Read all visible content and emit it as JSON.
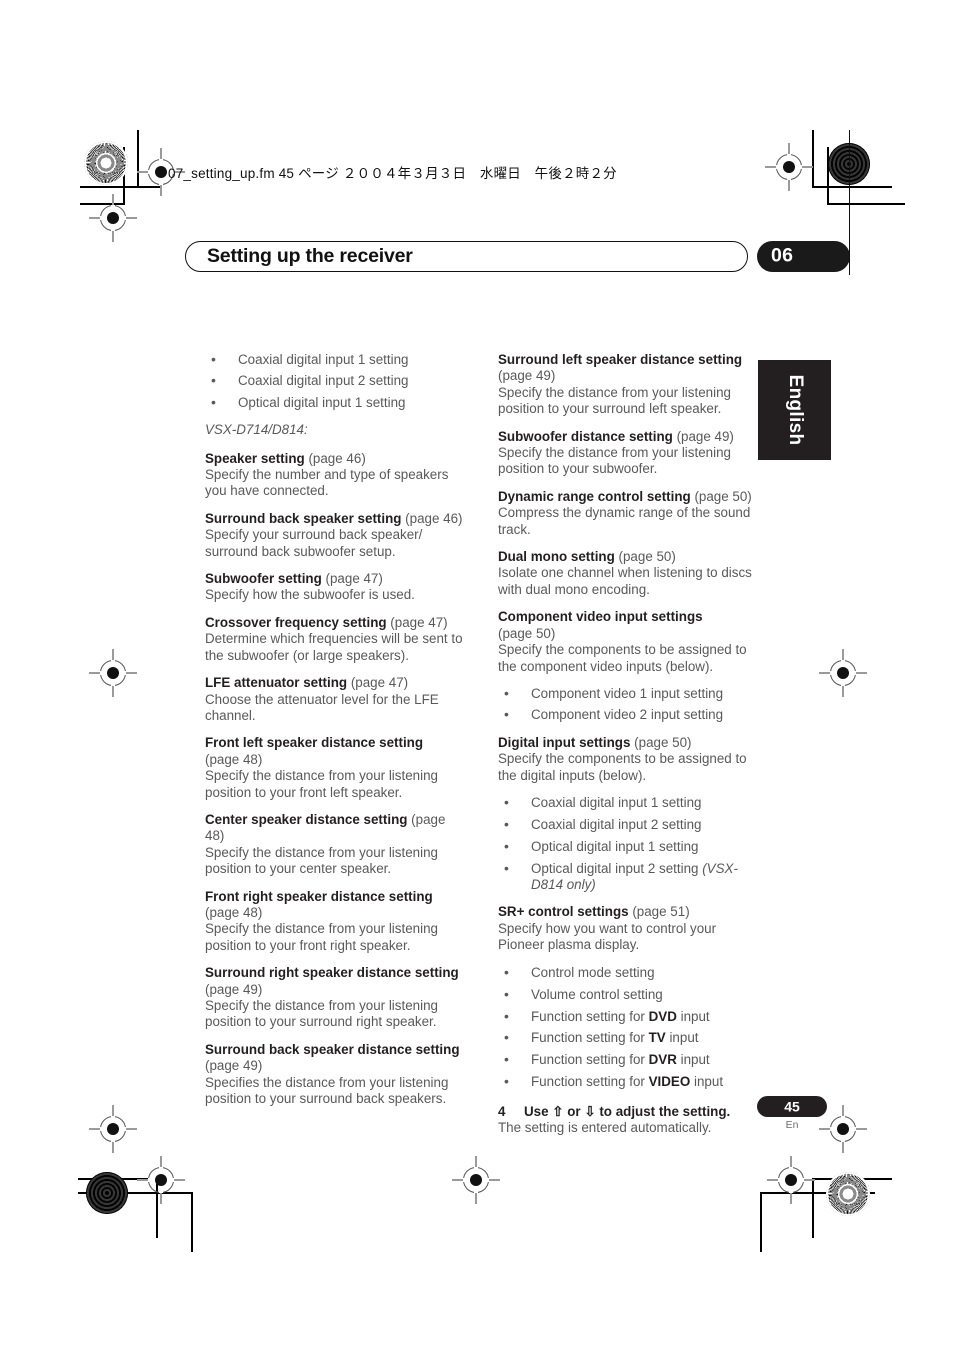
{
  "header": {
    "file_info": "07_setting_up.fm  45 ページ  ２００４年３月３日　水曜日　午後２時２分"
  },
  "title_bar": {
    "title": "Setting up the receiver",
    "chapter_number": "06"
  },
  "side_tab": {
    "label": "English"
  },
  "left_column": {
    "top_bullets": [
      "Coaxial digital input 1 setting",
      "Coaxial digital input 2 setting",
      "Optical digital input 1 setting"
    ],
    "model_note": "VSX-D714/D814:",
    "entries": [
      {
        "heading": "Speaker setting",
        "page_ref": "(page 46)",
        "page_on_new_line": false,
        "description": "Specify the number and type of speakers you have connected."
      },
      {
        "heading": "Surround back speaker setting",
        "page_ref": "(page 46)",
        "page_on_new_line": false,
        "description": "Specify your surround back speaker/ surround back subwoofer setup."
      },
      {
        "heading": "Subwoofer setting",
        "page_ref": "(page 47)",
        "page_on_new_line": false,
        "description": "Specify how the subwoofer is used."
      },
      {
        "heading": "Crossover frequency setting",
        "page_ref": "(page 47)",
        "page_on_new_line": false,
        "description": "Determine which frequencies will be sent to the subwoofer (or large speakers)."
      },
      {
        "heading": "LFE attenuator setting",
        "page_ref": "(page 47)",
        "page_on_new_line": false,
        "description": "Choose the attenuator level for the LFE channel."
      },
      {
        "heading": "Front left speaker distance setting",
        "page_ref": "(page 48)",
        "page_on_new_line": true,
        "description": "Specify the distance from your listening position to your front left speaker."
      },
      {
        "heading": "Center speaker distance setting",
        "page_ref": "(page 48)",
        "page_on_new_line": false,
        "description": "Specify the distance from your listening position to your center speaker."
      },
      {
        "heading": "Front right speaker distance setting",
        "page_ref": "(page 48)",
        "page_on_new_line": true,
        "description": "Specify the distance from your listening position to your front right speaker."
      },
      {
        "heading": "Surround right speaker distance setting",
        "page_ref": "(page 49)",
        "page_on_new_line": true,
        "description": "Specify the distance from your listening position to your surround right speaker."
      },
      {
        "heading": "Surround back speaker distance setting",
        "page_ref": "(page 49)",
        "page_on_new_line": true,
        "description": "Specifies the distance from your listening position to your surround back speakers."
      }
    ]
  },
  "right_column": {
    "entries": [
      {
        "heading": "Surround left speaker distance setting",
        "page_ref": "(page 49)",
        "page_on_new_line": true,
        "description": "Specify the distance from your listening position to your surround left speaker."
      },
      {
        "heading": "Subwoofer distance setting",
        "page_ref": "(page 49)",
        "page_on_new_line": false,
        "description": "Specify the distance from your listening position to your subwoofer."
      },
      {
        "heading": "Dynamic range control setting",
        "page_ref": "(page 50)",
        "page_on_new_line": false,
        "description": "Compress the dynamic range of the sound track."
      },
      {
        "heading": "Dual mono setting",
        "page_ref": "(page 50)",
        "page_on_new_line": false,
        "description": "Isolate one channel when listening to discs with dual mono encoding."
      }
    ],
    "component_video": {
      "heading": "Component video input settings",
      "page_ref": "(page 50)",
      "description": "Specify the components to be assigned to the component video inputs (below).",
      "bullets": [
        "Component video 1 input setting",
        "Component video 2 input setting"
      ]
    },
    "digital_input": {
      "heading": "Digital input settings",
      "page_ref": "(page 50)",
      "description": "Specify the components to be assigned to the digital inputs (below).",
      "bullets": [
        {
          "text": "Coaxial digital input 1 setting",
          "note": ""
        },
        {
          "text": "Coaxial digital input 2 setting",
          "note": ""
        },
        {
          "text": "Optical digital input 1 setting",
          "note": ""
        },
        {
          "text": "Optical digital input 2 setting",
          "note": "(VSX-D814 only)"
        }
      ]
    },
    "sr_plus": {
      "heading": "SR+ control settings",
      "page_ref": "(page 51)",
      "description": "Specify how you want to control your Pioneer plasma display.",
      "bullets": [
        {
          "prefix": "Control mode setting",
          "emphasis": "",
          "suffix": ""
        },
        {
          "prefix": "Volume control setting",
          "emphasis": "",
          "suffix": ""
        },
        {
          "prefix": "Function setting for ",
          "emphasis": "DVD",
          "suffix": " input"
        },
        {
          "prefix": "Function setting for ",
          "emphasis": "TV",
          "suffix": " input"
        },
        {
          "prefix": "Function setting for ",
          "emphasis": "DVR",
          "suffix": " input"
        },
        {
          "prefix": "Function setting for ",
          "emphasis": "VIDEO",
          "suffix": " input"
        }
      ]
    },
    "step": {
      "number": "4",
      "text_before": "Use ",
      "arrow_up": "⇧",
      "text_middle": " or ",
      "arrow_down": "⇩",
      "text_after": " to adjust the setting.",
      "sub": "The setting is entered automatically."
    }
  },
  "footer": {
    "page_number": "45",
    "language_code": "En"
  }
}
